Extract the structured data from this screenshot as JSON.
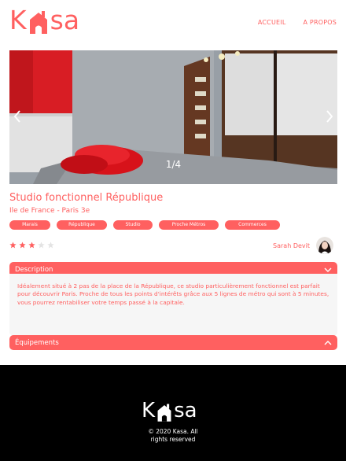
{
  "brand": {
    "name": "Kasa",
    "letter_k": "K",
    "letters_rest": "sa",
    "accent_color": "#FF6060"
  },
  "nav": {
    "items": [
      {
        "label": "ACCUEIL"
      },
      {
        "label": "A PROPOS"
      }
    ]
  },
  "gallery": {
    "counter": "1/4",
    "current": 1,
    "total": 4,
    "prev_icon": "chevron-left-icon",
    "next_icon": "chevron-right-icon"
  },
  "listing": {
    "title": "Studio fonctionnel République",
    "location": "Ile de France - Paris 3e",
    "tags": [
      "Marais",
      "République",
      "Studio",
      "Proche Métros",
      "Commerces"
    ],
    "rating": 3,
    "rating_max": 5,
    "host": {
      "name": "Sarah Devit"
    }
  },
  "description": {
    "title": "Description",
    "text": "Idéalement situé à 2 pas de la place de la République, ce studio particulièrement fonctionnel est parfait pour découvrir Paris. Proche de tous les points d'intérêts grâce aux 5 lignes de métro qui sont à 5 minutes, vous pourrez rentabiliser votre temps passé à la capitale.",
    "expanded": true
  },
  "equipments": {
    "title": "Équipements",
    "expanded": false
  },
  "footer": {
    "copyright_line1": "© 2020 Kasa. All",
    "copyright_line2": "rights reserved",
    "background": "#000000"
  }
}
